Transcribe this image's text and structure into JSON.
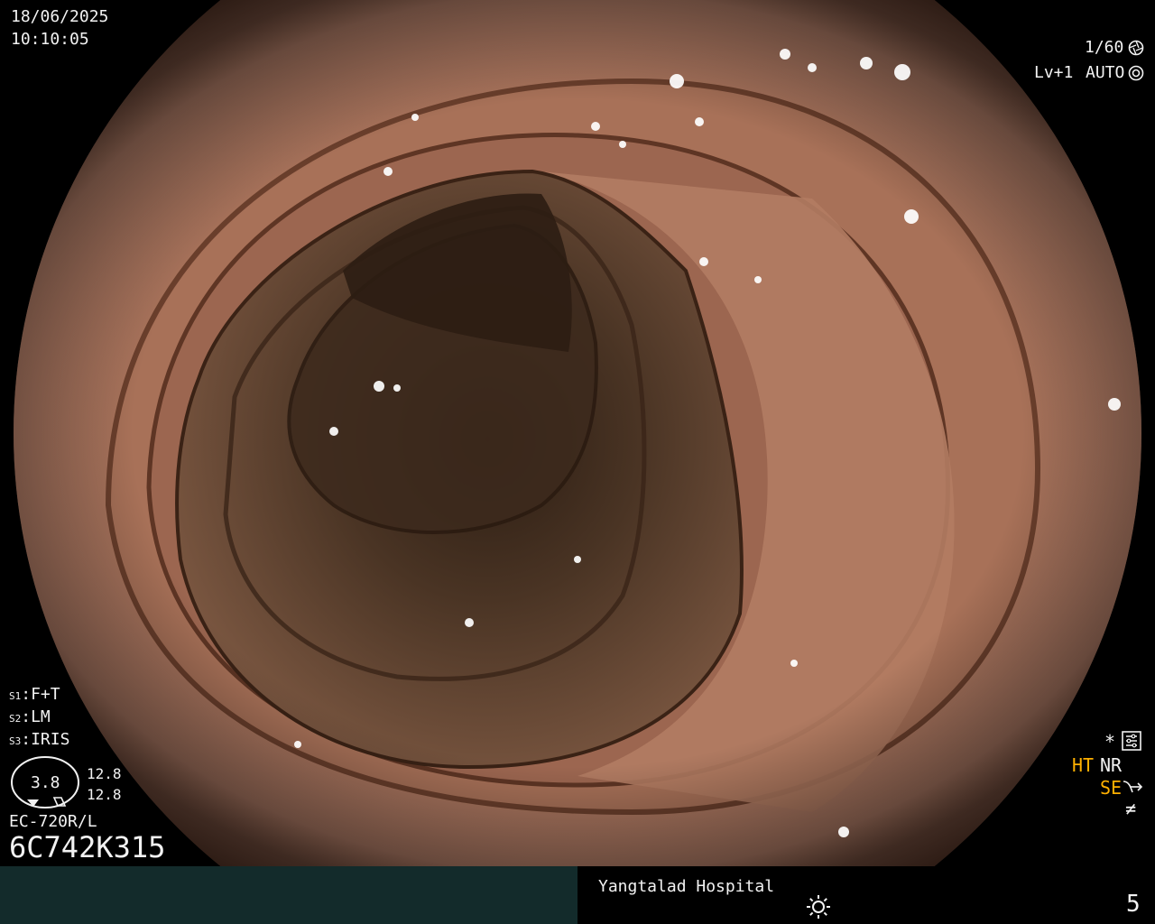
{
  "osd_top_left": {
    "date": "18/06/2025",
    "time": "10:10:05"
  },
  "osd_top_right": {
    "shutter": "1/60",
    "level": "Lv+1",
    "mode": "AUTO"
  },
  "settings": {
    "s1": {
      "key": "S1",
      "value": "F+T"
    },
    "s2": {
      "key": "S2",
      "value": "LM"
    },
    "s3": {
      "key": "S3",
      "value": "IRIS"
    }
  },
  "gauge": {
    "value": "3.8",
    "upper": "12.8",
    "lower": "12.8"
  },
  "scope": {
    "model": "EC-720R/L",
    "serial": "6C742K315"
  },
  "osd_right": {
    "star": "*",
    "ht": "HT",
    "nr": "NR",
    "se": "SE",
    "not_equal": "≠"
  },
  "footer": {
    "hospital": "Yangtalad Hospital",
    "page": "5"
  },
  "icons": {
    "shutter": "aperture-icon",
    "auto": "auto-iris-icon",
    "settings": "settings-sliders-icon",
    "sun": "sun-icon",
    "se_curve": "enhance-curve-icon"
  },
  "colors": {
    "footer_left": "#132b2b",
    "accent_yellow": "#ffb000",
    "text": "#f2f2f2"
  }
}
